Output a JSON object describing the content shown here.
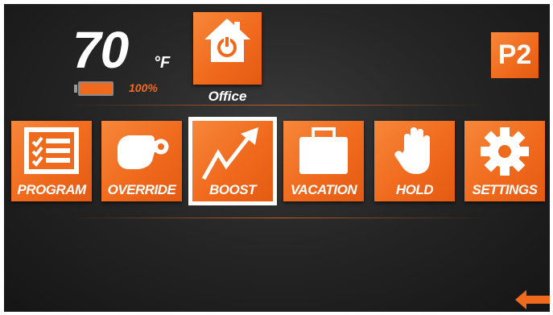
{
  "status": {
    "temperature": "70",
    "unit": "°F",
    "battery_percent": "100%",
    "battery_level": 1.0
  },
  "zone": {
    "label": "Office",
    "icon": "home-power-icon"
  },
  "profile": {
    "badge": "P2"
  },
  "menu": {
    "items": [
      {
        "label": "PROGRAM",
        "icon": "checklist-icon"
      },
      {
        "label": "OVERRIDE",
        "icon": "pointing-hand-icon"
      },
      {
        "label": "BOOST",
        "icon": "trend-up-arrow-icon",
        "selected": true
      },
      {
        "label": "VACATION",
        "icon": "suitcase-icon"
      },
      {
        "label": "HOLD",
        "icon": "hand-stop-icon"
      },
      {
        "label": "SETTINGS",
        "icon": "gear-icon"
      }
    ]
  },
  "navigation": {
    "back_icon": "back-arrow-icon"
  },
  "colors": {
    "accent": "#f06a1d",
    "background": "#262626",
    "text": "#ffffff"
  }
}
